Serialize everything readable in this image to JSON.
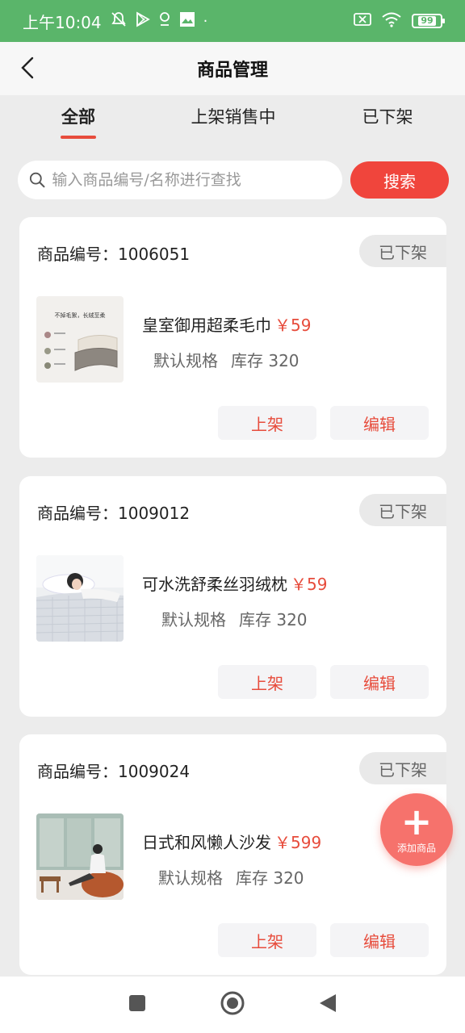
{
  "status": {
    "time": "上午10:04",
    "battery": "99",
    "dot": "·"
  },
  "nav": {
    "title": "商品管理"
  },
  "tabs": [
    {
      "label": "全部",
      "active": true
    },
    {
      "label": "上架销售中",
      "active": false
    },
    {
      "label": "已下架",
      "active": false
    }
  ],
  "search": {
    "placeholder": "输入商品编号/名称进行查找",
    "value": "",
    "button_label": "搜索"
  },
  "products": [
    {
      "code_label": "商品编号：1006051",
      "badge": "已下架",
      "name": "皇室御用超柔毛巾",
      "price": "￥59",
      "spec": "默认规格",
      "stock": "库存 320",
      "btn_on": "上架",
      "btn_edit": "编辑",
      "thumb_caption": "不掉毛絮，长絨至柔"
    },
    {
      "code_label": "商品编号：1009012",
      "badge": "已下架",
      "name": "可水洗舒柔丝羽绒枕",
      "price": "￥59",
      "spec": "默认规格",
      "stock": "库存 320",
      "btn_on": "上架",
      "btn_edit": "编辑"
    },
    {
      "code_label": "商品编号：1009024",
      "badge": "已下架",
      "name": "日式和风懒人沙发",
      "price": "￥599",
      "spec": "默认规格",
      "stock": "库存 320",
      "btn_on": "上架",
      "btn_edit": "编辑"
    }
  ],
  "fab": {
    "label": "添加商品"
  },
  "colors": {
    "status_bar": "#5ab56a",
    "accent": "#f0453c",
    "price": "#e74c3c",
    "fab": "#f6726c"
  },
  "icons": {
    "back": "chevron-left-icon",
    "search": "search-icon",
    "add": "plus-icon",
    "nav_home": "circle-home-icon",
    "nav_recent": "square-recent-icon",
    "nav_back": "triangle-back-icon"
  }
}
